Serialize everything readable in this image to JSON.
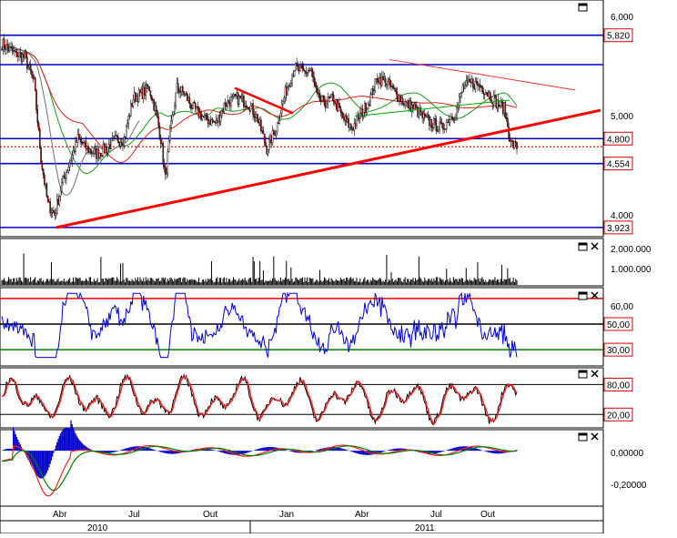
{
  "chart_data": [
    {
      "type": "candlestick",
      "panel": "price",
      "yticks": [
        "6,000",
        "5,000",
        "4,000"
      ],
      "ylim": [
        3850,
        6150
      ],
      "horizontal_levels": [
        {
          "value": 5820,
          "label": "5,820"
        },
        {
          "value": 5530,
          "label": ""
        },
        {
          "value": 4800,
          "label": "4,800"
        },
        {
          "value": 4554,
          "label": "4,554"
        },
        {
          "value": 3923,
          "label": "3,923"
        }
      ],
      "last_price_level": 4720,
      "trendline_support": {
        "from": {
          "date": "2010-04",
          "value": 3923
        },
        "to": {
          "date": "2011-12",
          "value": 5080
        }
      },
      "trendline_resistance": {
        "from": {
          "date": "2011-05",
          "value": 5580
        },
        "to": {
          "date": "2011-12",
          "value": 5280
        }
      },
      "series": [
        {
          "name": "",
          "color": "#000000",
          "role": "price"
        },
        {
          "name": "",
          "color": "#1a9c1a",
          "role": "moving-average"
        },
        {
          "name": "",
          "color": "#e02020",
          "role": "moving-average"
        },
        {
          "name": "",
          "color": "#707070",
          "role": "moving-average"
        }
      ]
    },
    {
      "type": "bar",
      "panel": "volume",
      "yticks": [
        "2.000.000",
        "1.000.000"
      ],
      "ylim": [
        0,
        2800000
      ]
    },
    {
      "type": "line",
      "panel": "rsi",
      "yticks": [
        "60,00"
      ],
      "ylim": [
        18,
        77
      ],
      "levels": [
        {
          "value": 70,
          "label": "",
          "color": "#ff0000"
        },
        {
          "value": 50,
          "label": "50,00",
          "color": "#000000"
        },
        {
          "value": 30,
          "label": "30,00",
          "color": "#008000"
        }
      ],
      "series": [
        {
          "name": "",
          "color": "#0000dd"
        }
      ]
    },
    {
      "type": "line",
      "panel": "stochastic",
      "ylim": [
        -5,
        110
      ],
      "levels": [
        {
          "value": 80,
          "label": "80,00"
        },
        {
          "value": 20,
          "label": "20,00"
        }
      ],
      "series": [
        {
          "name": "",
          "color": "#000000"
        },
        {
          "name": "",
          "color": "#ff2020"
        }
      ]
    },
    {
      "type": "line",
      "panel": "macd",
      "yticks": [
        "0,00000",
        "-0,20000"
      ],
      "ylim": [
        -0.34,
        0.12
      ],
      "series": [
        {
          "name": "",
          "color": "#ff2020"
        },
        {
          "name": "",
          "color": "#008000"
        },
        {
          "name": "",
          "color": "#0000cc",
          "style": "histogram"
        }
      ]
    }
  ],
  "x_axis": {
    "months": [
      "Abr",
      "Jul",
      "Out",
      "Jan",
      "Abr",
      "Jul",
      "Out"
    ],
    "years": [
      "2010",
      "2011"
    ]
  },
  "colors": {
    "level_line": "#0000cc",
    "label_border": "#dd0000",
    "label_text": "#dd0000"
  },
  "icons": {
    "panel_restore": "maximize-icon",
    "panel_close": "close-icon"
  }
}
